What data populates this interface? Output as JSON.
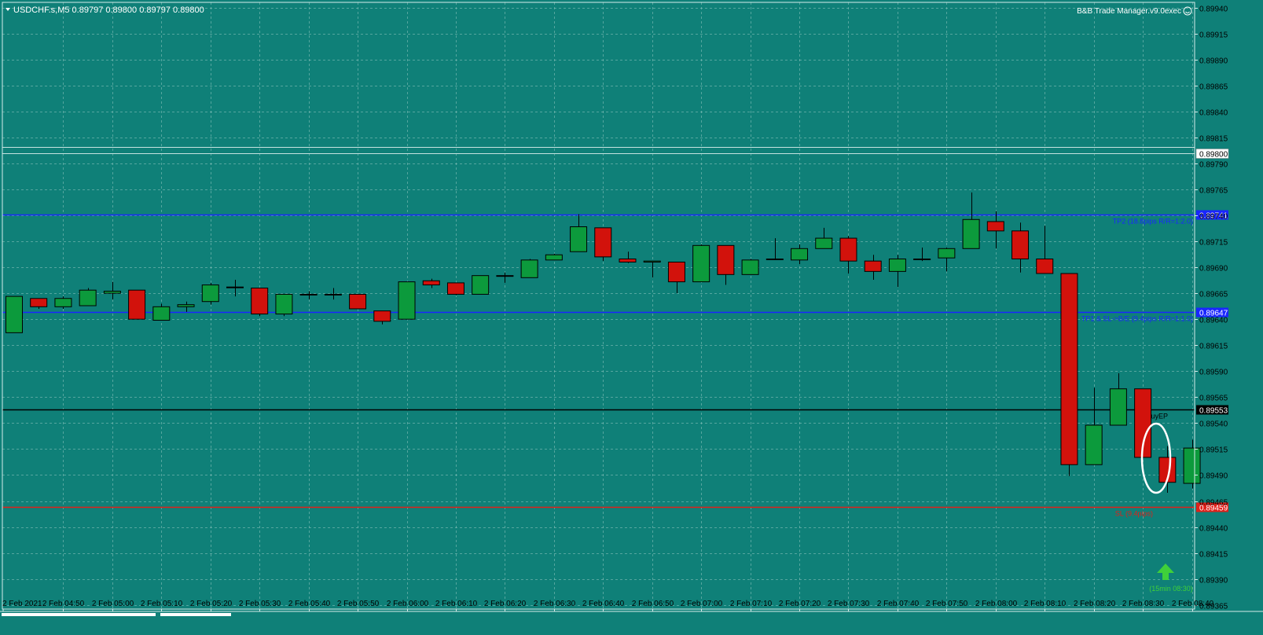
{
  "header": {
    "symbol_line": "USDCHF.s,M5  0.89797 0.89800 0.89797 0.89800",
    "indicator": "B&B Trade Manager.v9.0exec"
  },
  "colors": {
    "background": "#0f8078",
    "grid": "#8fc5bf",
    "bull": "#0c9a3c",
    "bear": "#d2120c",
    "wick": "#000000",
    "tp_line": "#1a26ff",
    "entry_line": "#000000",
    "sl_line": "#e0201a",
    "axis_text": "#000000"
  },
  "chart_data": {
    "type": "candlestick",
    "symbol": "USDCHF.s",
    "timeframe": "M5",
    "y_ticks": [
      "0.89940",
      "0.89915",
      "0.89890",
      "0.89865",
      "0.89840",
      "0.89815",
      "0.89790",
      "0.89765",
      "0.89740",
      "0.89715",
      "0.89690",
      "0.89665",
      "0.89640",
      "0.89615",
      "0.89590",
      "0.89565",
      "0.89540",
      "0.89515",
      "0.89490",
      "0.89465",
      "0.89440",
      "0.89415",
      "0.89390",
      "0.89365"
    ],
    "ylim": [
      0.89361,
      0.89945
    ],
    "x_ticks": [
      "2 Feb 2021",
      "2 Feb 04:50",
      "2 Feb 05:00",
      "2 Feb 05:10",
      "2 Feb 05:20",
      "2 Feb 05:30",
      "2 Feb 05:40",
      "2 Feb 05:50",
      "2 Feb 06:00",
      "2 Feb 06:10",
      "2 Feb 06:20",
      "2 Feb 06:30",
      "2 Feb 06:40",
      "2 Feb 06:50",
      "2 Feb 07:00",
      "2 Feb 07:10",
      "2 Feb 07:20",
      "2 Feb 07:30",
      "2 Feb 07:40",
      "2 Feb 07:50",
      "2 Feb 08:00",
      "2 Feb 08:10",
      "2 Feb 08:20",
      "2 Feb 08:30",
      "2 Feb 08:40"
    ],
    "candles": [
      {
        "o": 0.89627,
        "h": 0.89662,
        "l": 0.89627,
        "c": 0.89662
      },
      {
        "o": 0.8966,
        "h": 0.8966,
        "l": 0.8965,
        "c": 0.89652
      },
      {
        "o": 0.89652,
        "h": 0.89662,
        "l": 0.8965,
        "c": 0.8966
      },
      {
        "o": 0.89653,
        "h": 0.8967,
        "l": 0.89653,
        "c": 0.89668
      },
      {
        "o": 0.89665,
        "h": 0.89676,
        "l": 0.89659,
        "c": 0.89667
      },
      {
        "o": 0.89668,
        "h": 0.89668,
        "l": 0.8964,
        "c": 0.8964
      },
      {
        "o": 0.89639,
        "h": 0.89655,
        "l": 0.89639,
        "c": 0.89652
      },
      {
        "o": 0.89652,
        "h": 0.89657,
        "l": 0.89647,
        "c": 0.89654
      },
      {
        "o": 0.89657,
        "h": 0.89675,
        "l": 0.89654,
        "c": 0.89673
      },
      {
        "o": 0.89671,
        "h": 0.89678,
        "l": 0.89662,
        "c": 0.89671
      },
      {
        "o": 0.8967,
        "h": 0.8967,
        "l": 0.89643,
        "c": 0.89645
      },
      {
        "o": 0.89645,
        "h": 0.89664,
        "l": 0.89643,
        "c": 0.89664
      },
      {
        "o": 0.89664,
        "h": 0.89667,
        "l": 0.89659,
        "c": 0.89664
      },
      {
        "o": 0.89664,
        "h": 0.8967,
        "l": 0.89659,
        "c": 0.89664
      },
      {
        "o": 0.89664,
        "h": 0.89664,
        "l": 0.8965,
        "c": 0.8965
      },
      {
        "o": 0.89648,
        "h": 0.89648,
        "l": 0.89635,
        "c": 0.89638
      },
      {
        "o": 0.8964,
        "h": 0.89676,
        "l": 0.8964,
        "c": 0.89676
      },
      {
        "o": 0.89677,
        "h": 0.89679,
        "l": 0.8967,
        "c": 0.89673
      },
      {
        "o": 0.89675,
        "h": 0.89675,
        "l": 0.89663,
        "c": 0.89664
      },
      {
        "o": 0.89664,
        "h": 0.89682,
        "l": 0.89664,
        "c": 0.89682
      },
      {
        "o": 0.89682,
        "h": 0.89685,
        "l": 0.89675,
        "c": 0.89682
      },
      {
        "o": 0.8968,
        "h": 0.89698,
        "l": 0.8968,
        "c": 0.89697
      },
      {
        "o": 0.89697,
        "h": 0.89703,
        "l": 0.89697,
        "c": 0.89702
      },
      {
        "o": 0.89705,
        "h": 0.89741,
        "l": 0.89705,
        "c": 0.89729
      },
      {
        "o": 0.89728,
        "h": 0.89728,
        "l": 0.89696,
        "c": 0.897
      },
      {
        "o": 0.89698,
        "h": 0.89705,
        "l": 0.89694,
        "c": 0.89695
      },
      {
        "o": 0.89695,
        "h": 0.89695,
        "l": 0.8968,
        "c": 0.89696
      },
      {
        "o": 0.89695,
        "h": 0.89695,
        "l": 0.89665,
        "c": 0.89676
      },
      {
        "o": 0.89676,
        "h": 0.89712,
        "l": 0.89676,
        "c": 0.89711
      },
      {
        "o": 0.89711,
        "h": 0.89711,
        "l": 0.89673,
        "c": 0.89683
      },
      {
        "o": 0.89683,
        "h": 0.89698,
        "l": 0.89683,
        "c": 0.89697
      },
      {
        "o": 0.89698,
        "h": 0.89718,
        "l": 0.89698,
        "c": 0.89698
      },
      {
        "o": 0.89697,
        "h": 0.89712,
        "l": 0.89693,
        "c": 0.89708
      },
      {
        "o": 0.89708,
        "h": 0.89728,
        "l": 0.89708,
        "c": 0.89718
      },
      {
        "o": 0.89718,
        "h": 0.8972,
        "l": 0.89684,
        "c": 0.89696
      },
      {
        "o": 0.89696,
        "h": 0.89702,
        "l": 0.89678,
        "c": 0.89686
      },
      {
        "o": 0.89686,
        "h": 0.89702,
        "l": 0.89671,
        "c": 0.89698
      },
      {
        "o": 0.89698,
        "h": 0.89709,
        "l": 0.89696,
        "c": 0.89698
      },
      {
        "o": 0.89699,
        "h": 0.89709,
        "l": 0.89686,
        "c": 0.89708
      },
      {
        "o": 0.89708,
        "h": 0.89762,
        "l": 0.89708,
        "c": 0.89736
      },
      {
        "o": 0.89734,
        "h": 0.89744,
        "l": 0.89708,
        "c": 0.89725
      },
      {
        "o": 0.89725,
        "h": 0.89733,
        "l": 0.89685,
        "c": 0.89698
      },
      {
        "o": 0.89698,
        "h": 0.8973,
        "l": 0.89685,
        "c": 0.89684
      },
      {
        "o": 0.89684,
        "h": 0.89684,
        "l": 0.89489,
        "c": 0.895
      },
      {
        "o": 0.895,
        "h": 0.89574,
        "l": 0.895,
        "c": 0.89538
      },
      {
        "o": 0.89538,
        "h": 0.89588,
        "l": 0.89538,
        "c": 0.89573
      },
      {
        "o": 0.89573,
        "h": 0.89573,
        "l": 0.89508,
        "c": 0.89507
      },
      {
        "o": 0.89507,
        "h": 0.89518,
        "l": 0.89473,
        "c": 0.89483
      },
      {
        "o": 0.89482,
        "h": 0.89524,
        "l": 0.89477,
        "c": 0.89516
      }
    ],
    "levels": [
      {
        "name": "tp2",
        "price": 0.89741,
        "price_label": "0.89741",
        "label": "TP2 (18.8pips R/R=1:2.0)",
        "role": "tp"
      },
      {
        "name": "tp1",
        "price": 0.89647,
        "price_label": "0.89647",
        "label": "TP1 & SL->B/E (9.4pips R/R=1:1.0)",
        "role": "tp"
      },
      {
        "name": "entry",
        "price": 0.89553,
        "price_label": "0.89553",
        "label": "BuyEP",
        "role": "entry"
      },
      {
        "name": "sl",
        "price": 0.89459,
        "price_label": "0.89459",
        "label": "SL (9.4pips)",
        "role": "sl"
      }
    ],
    "bid": {
      "price": 0.898,
      "label": "0.89800"
    },
    "signal": {
      "label": "(15min 08:30)"
    },
    "grid": true
  }
}
